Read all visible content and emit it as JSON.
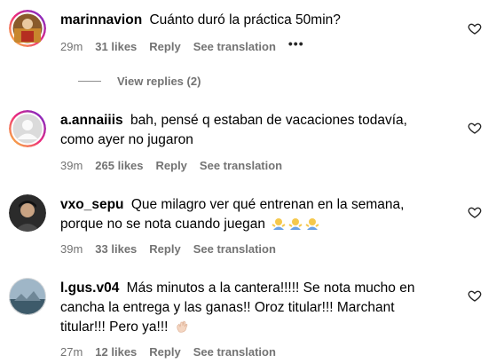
{
  "comments": [
    {
      "username": "marinnavion",
      "text": "Cuánto duró la práctica 50min?",
      "age": "29m",
      "likes": "31 likes",
      "reply_label": "Reply",
      "translate_label": "See translation",
      "more_label": "•••",
      "view_replies": "View replies (2)"
    },
    {
      "username": "a.annaiiis",
      "text": "bah, pensé q estaban de vacaciones todavía, como ayer no jugaron",
      "age": "39m",
      "likes": "265 likes",
      "reply_label": "Reply",
      "translate_label": "See translation"
    },
    {
      "username": "vxo_sepu",
      "text": "Que milagro ver qué entrenan en la semana, porque no se nota cuando juegan",
      "emojis": [
        "person-shrugging",
        "person-shrugging",
        "person-shrugging"
      ],
      "age": "39m",
      "likes": "33 likes",
      "reply_label": "Reply",
      "translate_label": "See translation"
    },
    {
      "username": "l.gus.v04",
      "text": "Más minutos a la cantera!!!!! Se nota mucho en cancha la entrega y las ganas!! Oroz titular!!! Marchant titular!!! Pero ya!!!",
      "emojis": [
        "waving-hand"
      ],
      "age": "27m",
      "likes": "12 likes",
      "reply_label": "Reply",
      "translate_label": "See translation"
    }
  ],
  "colors": {
    "meta": "#737373",
    "story_ring": "#e1306c",
    "text": "#000000"
  }
}
